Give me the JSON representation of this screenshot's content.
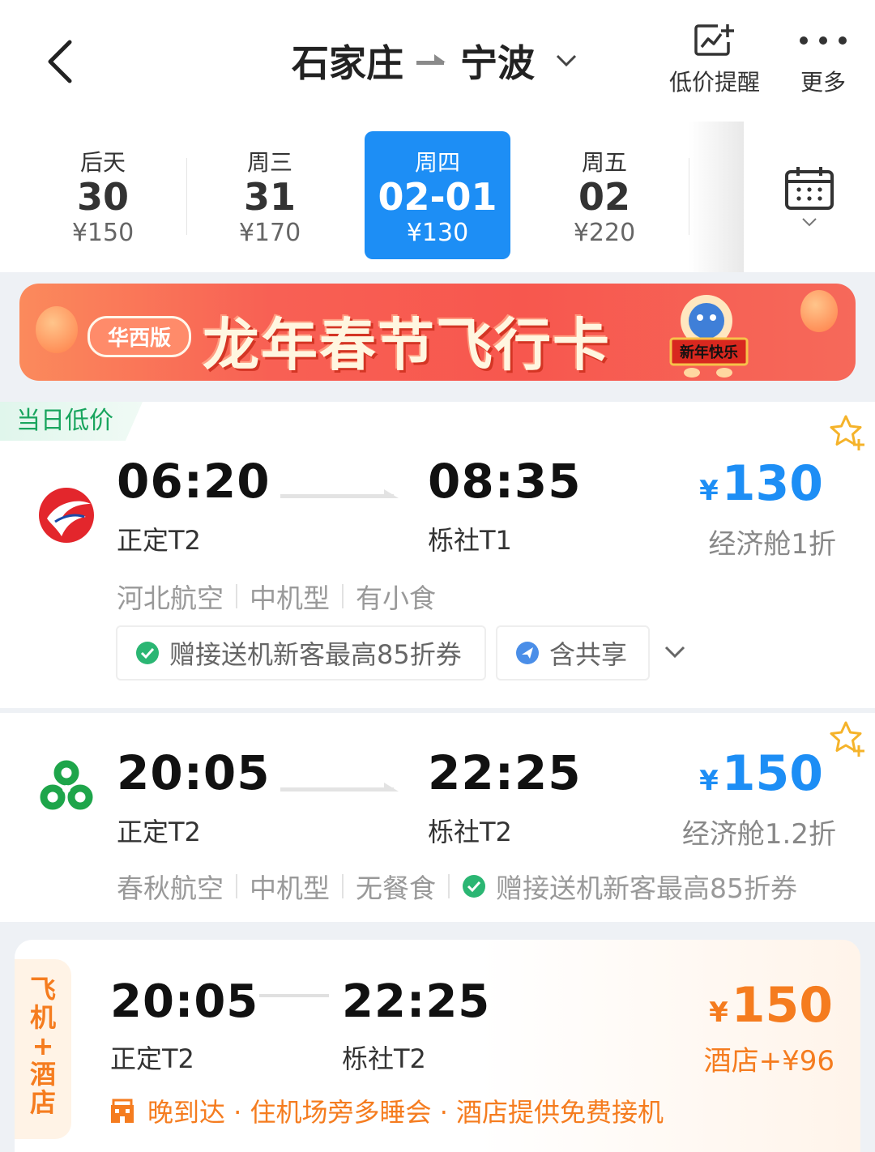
{
  "header": {
    "origin": "石家庄",
    "destination": "宁波",
    "price_alert_label": "低价提醒",
    "more_label": "更多"
  },
  "dates": [
    {
      "weekday": "后天",
      "day": "30",
      "price": "¥150"
    },
    {
      "weekday": "周三",
      "day": "31",
      "price": "¥170"
    },
    {
      "weekday": "周四",
      "day": "02-01",
      "price": "¥130",
      "selected": true
    },
    {
      "weekday": "周五",
      "day": "02",
      "price": "¥220"
    }
  ],
  "banner": {
    "pill": "华西版",
    "headline": "龙年春节飞行卡",
    "mascot_sign": "新年快乐"
  },
  "flights": [
    {
      "tag": "当日低价",
      "airline_logo": "hebei-airlines-logo",
      "depart_time": "06:20",
      "depart_terminal": "正定T2",
      "arrive_time": "08:35",
      "arrive_terminal": "栎社T1",
      "currency": "¥",
      "price": "130",
      "cabin": "经济舱1折",
      "airline": "河北航空",
      "aircraft": "中机型",
      "meal": "有小食",
      "chip_coupon": "赠接送机新客最高85折券",
      "chip_share": "含共享"
    },
    {
      "airline_logo": "spring-airlines-logo",
      "depart_time": "20:05",
      "depart_terminal": "正定T2",
      "arrive_time": "22:25",
      "arrive_terminal": "栎社T2",
      "currency": "¥",
      "price": "150",
      "cabin": "经济舱1.2折",
      "airline": "春秋航空",
      "aircraft": "中机型",
      "meal": "无餐食",
      "coupon": "赠接送机新客最高85折券"
    }
  ],
  "package": {
    "side_label": [
      "飞",
      "机",
      "+",
      "酒",
      "店"
    ],
    "depart_time": "20:05",
    "depart_terminal": "正定T2",
    "arrive_time": "22:25",
    "arrive_terminal": "栎社T2",
    "currency": "¥",
    "price": "150",
    "hotel_extra": "酒店+¥96",
    "perk": "晚到达 · 住机场旁多睡会 · 酒店提供免费接机"
  },
  "colors": {
    "accent_blue": "#1d8ef5",
    "low_price_green": "#19a55e",
    "package_orange": "#f57c1f",
    "banner_red": "#f7574e"
  }
}
